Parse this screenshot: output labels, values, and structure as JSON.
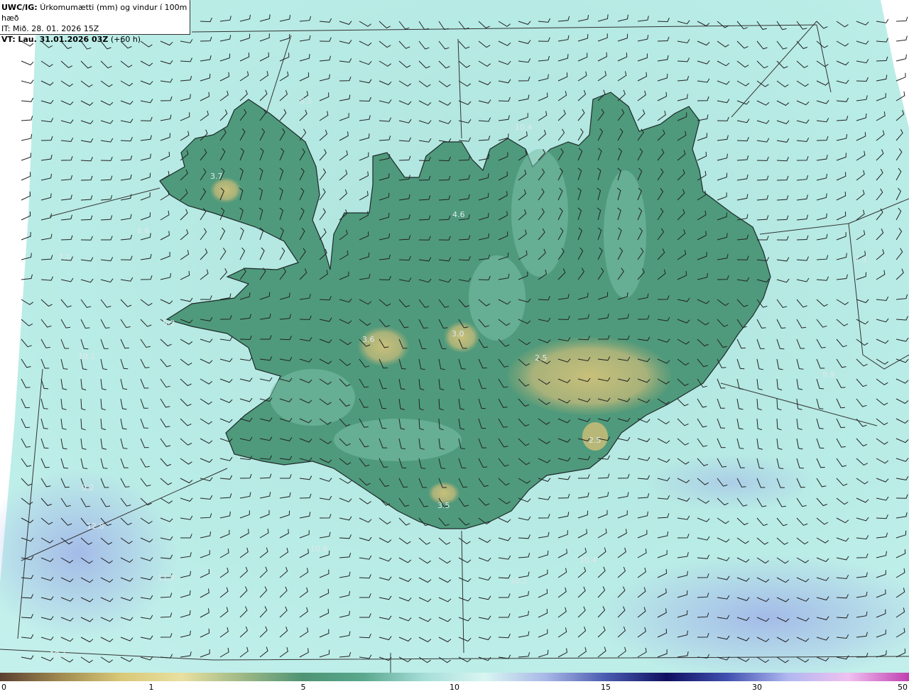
{
  "header": {
    "model": "UWC/IG:",
    "title": "Úrkomumætti (mm) og vindur í 100m hæð",
    "it_line": "IT: Mið. 28. 01. 2026 15Z",
    "vt_prefix": "VT:",
    "vt_value": "Lau. 31.01.2026 03Z",
    "vt_suffix": "(+60 h)"
  },
  "value_labels": [
    "3.7",
    "4.6",
    "10.4",
    "7.1",
    "5.2",
    "3.6",
    "3.0",
    "2.5",
    "2.5",
    "3.5",
    "10.1",
    "7.3",
    "9.9",
    "9.2",
    "12.8",
    "10.6",
    "11.9",
    "10.4",
    "10.2",
    "12.1",
    "6.6",
    "5.5"
  ],
  "colorbar": {
    "ticks": [
      "0",
      "1",
      "5",
      "10",
      "15",
      "30",
      "50"
    ],
    "colors": [
      "#5a4030",
      "#a08a50",
      "#d8c878",
      "#e8e0a0",
      "#9eb886",
      "#4e9474",
      "#5aa88e",
      "#a6ddd8",
      "#d9f6f2",
      "#a9b8e6",
      "#4a5ab0",
      "#101060",
      "#4050b0",
      "#b0b8f0",
      "#f0c0f0",
      "#c040b0"
    ]
  },
  "colors": {
    "land_low": "#3f8c6e",
    "land_high": "#b0b070",
    "sea": "#bfece6"
  }
}
